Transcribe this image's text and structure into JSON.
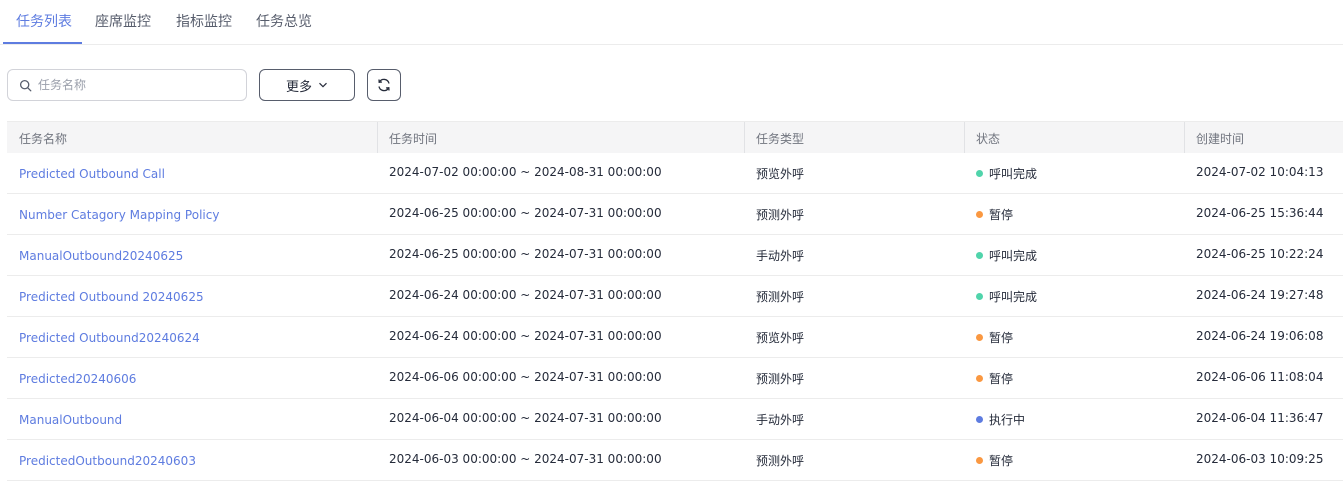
{
  "tabs": [
    {
      "label": "任务列表",
      "active": true
    },
    {
      "label": "座席监控",
      "active": false
    },
    {
      "label": "指标监控",
      "active": false
    },
    {
      "label": "任务总览",
      "active": false
    }
  ],
  "toolbar": {
    "search_placeholder": "任务名称",
    "search_value": "",
    "more_label": "更多",
    "refresh_icon": "refresh-icon"
  },
  "table": {
    "columns": [
      "任务名称",
      "任务时间",
      "任务类型",
      "状态",
      "创建时间"
    ],
    "rows": [
      {
        "name": "Predicted Outbound Call",
        "time": "2024-07-02 00:00:00 ~ 2024-08-31 00:00:00",
        "type": "预览外呼",
        "status": "呼叫完成",
        "status_color": "#50d4ab",
        "created": "2024-07-02 10:04:13"
      },
      {
        "name": "Number Catagory Mapping Policy",
        "time": "2024-06-25 00:00:00 ~ 2024-07-31 00:00:00",
        "type": "预测外呼",
        "status": "暂停",
        "status_color": "#fa9841",
        "created": "2024-06-25 15:36:44"
      },
      {
        "name": "ManualOutbound20240625",
        "time": "2024-06-25 00:00:00 ~ 2024-07-31 00:00:00",
        "type": "手动外呼",
        "status": "呼叫完成",
        "status_color": "#50d4ab",
        "created": "2024-06-25 10:22:24"
      },
      {
        "name": "Predicted Outbound 20240625",
        "time": "2024-06-24 00:00:00 ~ 2024-07-31 00:00:00",
        "type": "预测外呼",
        "status": "呼叫完成",
        "status_color": "#50d4ab",
        "created": "2024-06-24 19:27:48"
      },
      {
        "name": "Predicted Outbound20240624",
        "time": "2024-06-24 00:00:00 ~ 2024-07-31 00:00:00",
        "type": "预览外呼",
        "status": "暂停",
        "status_color": "#fa9841",
        "created": "2024-06-24 19:06:08"
      },
      {
        "name": "Predicted20240606",
        "time": "2024-06-06 00:00:00 ~ 2024-07-31 00:00:00",
        "type": "预测外呼",
        "status": "暂停",
        "status_color": "#fa9841",
        "created": "2024-06-06 11:08:04"
      },
      {
        "name": "ManualOutbound",
        "time": "2024-06-04 00:00:00 ~ 2024-07-31 00:00:00",
        "type": "手动外呼",
        "status": "执行中",
        "status_color": "#5e7ce0",
        "created": "2024-06-04 11:36:47"
      },
      {
        "name": "PredictedOutbound20240603",
        "time": "2024-06-03 00:00:00 ~ 2024-07-31 00:00:00",
        "type": "预测外呼",
        "status": "暂停",
        "status_color": "#fa9841",
        "created": "2024-06-03 10:09:25"
      }
    ]
  },
  "colors": {
    "accent": "#5e7ce0",
    "complete": "#50d4ab",
    "paused": "#fa9841",
    "running": "#5e7ce0"
  }
}
